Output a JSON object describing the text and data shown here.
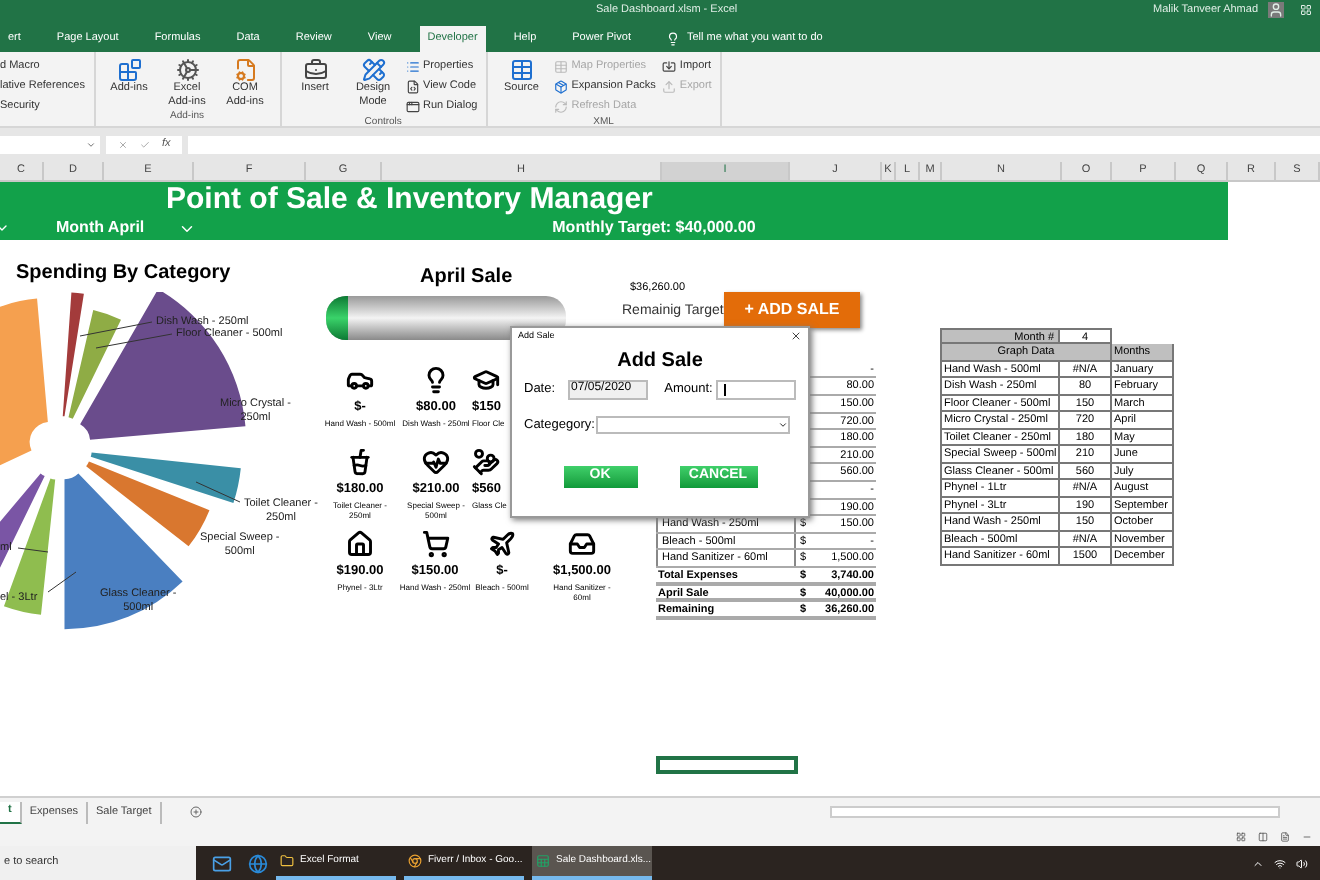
{
  "title_bar": {
    "title": "Sale Dashboard.xlsm  -  Excel",
    "user": "Malik Tanveer Ahmad"
  },
  "ribbon_tabs": [
    {
      "label": "ert",
      "selected": false
    },
    {
      "label": "Page Layout",
      "selected": false
    },
    {
      "label": "Formulas",
      "selected": false
    },
    {
      "label": "Data",
      "selected": false
    },
    {
      "label": "Review",
      "selected": false
    },
    {
      "label": "View",
      "selected": false
    },
    {
      "label": "Developer",
      "selected": true
    },
    {
      "label": "Help",
      "selected": false
    },
    {
      "label": "Power Pivot",
      "selected": false
    }
  ],
  "tell_me": "Tell me what you want to do",
  "ribbon_groups": [
    {
      "items": [
        {
          "label": "d Macro",
          "kind": "text",
          "disabled": false
        },
        {
          "label": "lative References",
          "kind": "text",
          "disabled": false
        },
        {
          "label": "Security",
          "kind": "text",
          "disabled": false
        }
      ]
    },
    {
      "label": "Add-ins",
      "items": [
        {
          "label": "Add-ins",
          "kind": "large",
          "disabled": false
        },
        {
          "label": "Excel Add-ins",
          "kind": "large",
          "disabled": false
        },
        {
          "label": "COM Add-ins",
          "kind": "large",
          "disabled": false
        }
      ]
    },
    {
      "label": "Controls",
      "items": [
        {
          "label": "Insert",
          "kind": "large",
          "disabled": false
        },
        {
          "label": "Design Mode",
          "kind": "large",
          "disabled": false
        },
        {
          "label": "Properties",
          "kind": "small",
          "disabled": false
        },
        {
          "label": "View Code",
          "kind": "small",
          "disabled": false
        },
        {
          "label": "Run Dialog",
          "kind": "small",
          "disabled": false
        }
      ]
    },
    {
      "label": "XML",
      "items": [
        {
          "label": "Source",
          "kind": "large",
          "disabled": false
        },
        {
          "label": "Map Properties",
          "kind": "small",
          "disabled": true
        },
        {
          "label": "Expansion Packs",
          "kind": "small",
          "disabled": false
        },
        {
          "label": "Refresh Data",
          "kind": "small",
          "disabled": true
        },
        {
          "label": "Import",
          "kind": "small",
          "disabled": false
        },
        {
          "label": "Export",
          "kind": "small",
          "disabled": true
        }
      ]
    }
  ],
  "formula_bar": {
    "fx": "fx"
  },
  "columns": [
    {
      "label": "C",
      "selected": false
    },
    {
      "label": "D",
      "selected": false
    },
    {
      "label": "E",
      "selected": false
    },
    {
      "label": "F",
      "selected": false
    },
    {
      "label": "G",
      "selected": false
    },
    {
      "label": "H",
      "selected": false
    },
    {
      "label": "I",
      "selected": true
    },
    {
      "label": "J",
      "selected": false
    },
    {
      "label": "K",
      "selected": false
    },
    {
      "label": "L",
      "selected": false
    },
    {
      "label": "M",
      "selected": false
    },
    {
      "label": "N",
      "selected": false
    },
    {
      "label": "O",
      "selected": false
    },
    {
      "label": "P",
      "selected": false
    },
    {
      "label": "Q",
      "selected": false
    },
    {
      "label": "R",
      "selected": false
    },
    {
      "label": "S",
      "selected": false
    }
  ],
  "banner": {
    "title": "Point of Sale & Inventory Manager",
    "month": "Month April",
    "target": "Monthly Target: $40,000.00"
  },
  "spending": {
    "title": "Spending By Category",
    "labels": [
      "Dish Wash - 250ml",
      "Floor Cleaner - 500ml",
      "Micro Crystal -\n250ml",
      "Toilet Cleaner -\n250ml",
      "Special Sweep -\n500ml",
      "Glass Cleaner -\n500ml",
      "ml",
      "el - 3Ltr"
    ]
  },
  "april_sale": {
    "title": "April Sale",
    "level": 0.09
  },
  "icon_tiles": [
    [
      {
        "amount": "$-",
        "label": "Hand Wash - 500ml"
      },
      {
        "amount": "$80.00",
        "label": "Dish Wash - 250ml"
      },
      {
        "amount": "$150",
        "label": "Floor Cle"
      }
    ],
    [
      {
        "amount": "$180.00",
        "label": "Toilet Cleaner -\n250ml"
      },
      {
        "amount": "$210.00",
        "label": "Special Sweep -\n500ml"
      },
      {
        "amount": "$560",
        "label": "Glass Cle"
      }
    ],
    [
      {
        "amount": "$190.00",
        "label": "Phynel - 3Ltr"
      },
      {
        "amount": "$150.00",
        "label": "Hand Wash - 250ml"
      },
      {
        "amount": "$-",
        "label": "Bleach - 500ml"
      },
      {
        "amount": "$1,500.00",
        "label": "Hand Sanitizer -\n60ml"
      }
    ]
  ],
  "remaining": {
    "amount": "$36,260.00",
    "label": "Remainig Target"
  },
  "add_sale_button": "+ ADD SALE",
  "expense_table": {
    "rows": [
      {
        "value": "-"
      },
      {
        "value": "80.00"
      },
      {
        "value": "150.00"
      },
      {
        "value": "720.00"
      },
      {
        "value": "180.00"
      },
      {
        "value": "210.00"
      },
      {
        "value": "560.00"
      },
      {
        "value": "-"
      },
      {
        "value": "190.00"
      },
      {
        "name": "Hand Wash - 250ml",
        "currency": "$",
        "value": "150.00"
      },
      {
        "name": "Bleach - 500ml",
        "currency": "$",
        "value": "-"
      },
      {
        "name": "Hand Sanitizer - 60ml",
        "currency": "$",
        "value": "1,500.00"
      }
    ],
    "totals": [
      {
        "name": "Total Expenses",
        "currency": "$",
        "value": "3,740.00"
      },
      {
        "name": "April Sale",
        "currency": "$",
        "value": "40,000.00"
      },
      {
        "name": "Remaining",
        "currency": "$",
        "value": "36,260.00"
      }
    ]
  },
  "graph_table": {
    "month_label": "Month #",
    "month_value": "4",
    "header": "Graph Data",
    "months_header": "Months",
    "rows": [
      {
        "name": "Hand Wash - 500ml",
        "value": "#N/A",
        "month": "January"
      },
      {
        "name": "Dish Wash - 250ml",
        "value": "80",
        "month": "February"
      },
      {
        "name": "Floor Cleaner - 500ml",
        "value": "150",
        "month": "March"
      },
      {
        "name": "Micro Crystal - 250ml",
        "value": "720",
        "month": "April"
      },
      {
        "name": "Toilet Cleaner - 250ml",
        "value": "180",
        "month": "May"
      },
      {
        "name": "Special Sweep - 500ml",
        "value": "210",
        "month": "June"
      },
      {
        "name": "Glass Cleaner - 500ml",
        "value": "560",
        "month": "July"
      },
      {
        "name": "Phynel - 1Ltr",
        "value": "#N/A",
        "month": "August"
      },
      {
        "name": "Phynel - 3Ltr",
        "value": "190",
        "month": "September"
      },
      {
        "name": "Hand Wash - 250ml",
        "value": "150",
        "month": "October"
      },
      {
        "name": "Bleach - 500ml",
        "value": "#N/A",
        "month": "November"
      },
      {
        "name": "Hand Sanitizer - 60ml",
        "value": "1500",
        "month": "December"
      }
    ]
  },
  "dialog": {
    "window_title": "Add Sale",
    "heading": "Add Sale",
    "date_label": "Date:",
    "date_value": "07/05/2020",
    "amount_label": "Amount:",
    "category_label": "Categegory:",
    "ok": "OK",
    "cancel": "CANCEL"
  },
  "sheet_tabs": [
    {
      "label": "t",
      "selected": true
    },
    {
      "label": "Expenses",
      "selected": false
    },
    {
      "label": "Sale Target",
      "selected": false
    }
  ],
  "taskbar": {
    "search": "e to search",
    "apps": [
      {
        "label": "Excel Format",
        "kind": "folder",
        "selected": false
      },
      {
        "label": "Fiverr / Inbox - Goo...",
        "kind": "browser",
        "selected": false
      },
      {
        "label": "Sale Dashboard.xls...",
        "kind": "excel",
        "selected": true
      }
    ]
  }
}
